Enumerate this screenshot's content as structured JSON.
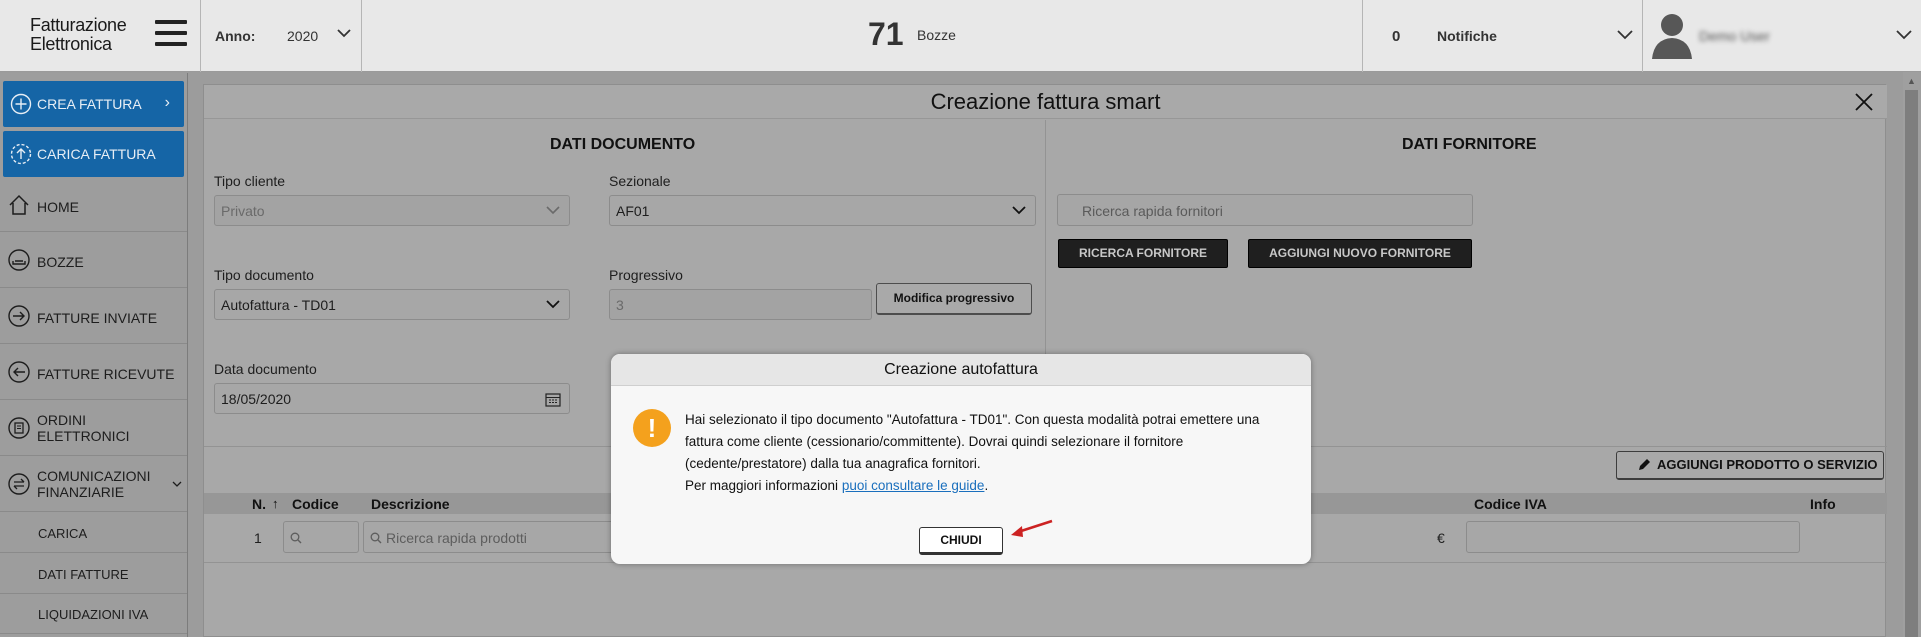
{
  "header": {
    "brand_line1": "Fatturazione",
    "brand_line2": "Elettronica",
    "anno_label": "Anno:",
    "anno_value": "2020",
    "bozze_count": "71",
    "bozze_label": "Bozze",
    "notifiche_count": "0",
    "notifiche_label": "Notifiche",
    "username": "Demo User"
  },
  "sidebar": {
    "crea_fattura": "CREA FATTURA",
    "carica_fattura": "CARICA FATTURA",
    "items": [
      {
        "label": "HOME",
        "icon": "home-icon"
      },
      {
        "label": "BOZZE",
        "icon": "drafts-icon"
      },
      {
        "label": "FATTURE INVIATE",
        "icon": "sent-icon"
      },
      {
        "label": "FATTURE RICEVUTE",
        "icon": "received-icon"
      },
      {
        "label": "ORDINI ELETTRONICI",
        "line1": "ORDINI",
        "line2": "ELETTRONICI",
        "icon": "orders-icon"
      },
      {
        "label": "COMUNICAZIONI FINANZIARIE",
        "line1": "COMUNICAZIONI",
        "line2": "FINANZIARIE",
        "icon": "exchange-icon"
      }
    ],
    "subitems": [
      "CARICA",
      "DATI FATTURE",
      "LIQUIDAZIONI IVA"
    ]
  },
  "panel": {
    "title": "Creazione fattura smart",
    "dati_documento": "DATI DOCUMENTO",
    "dati_fornitore": "DATI FORNITORE",
    "tipo_cliente_label": "Tipo cliente",
    "tipo_cliente_value": "Privato",
    "sezionale_label": "Sezionale",
    "sezionale_value": "AF01",
    "tipo_documento_label": "Tipo documento",
    "tipo_documento_value": "Autofattura - TD01",
    "progressivo_label": "Progressivo",
    "progressivo_value": "3",
    "modifica_progressivo": "Modifica progressivo",
    "data_documento_label": "Data documento",
    "data_documento_value": "18/05/2020",
    "ricerca_fornitori_placeholder": "Ricerca rapida fornitori",
    "ricerca_fornitore_btn": "RICERCA FORNITORE",
    "aggiungi_fornitore_btn": "AGGIUNGI NUOVO FORNITORE",
    "aggiungi_prodotto_btn": "AGGIUNGI PRODOTTO O SERVIZIO",
    "table_headers": {
      "n": "N.",
      "codice": "Codice",
      "descrizione": "Descrizione",
      "codice_iva": "Codice IVA",
      "info": "Info"
    },
    "row": {
      "n": "1",
      "ricerca_prodotti_placeholder": "Ricerca rapida prodotti",
      "currency": "€"
    }
  },
  "modal": {
    "title": "Creazione autofattura",
    "text_part1": "Hai selezionato il tipo documento \"Autofattura - TD01\". Con questa modalità potrai emettere una fattura come cliente (cessionario/committente). Dovrai quindi selezionare il fornitore (cedente/prestatore) dalla tua anagrafica fornitori.",
    "text_part2": "Per maggiori informazioni",
    "link_text": "puoi consultare le guide",
    "text_part3": ".",
    "close_button": "CHIUDI"
  },
  "colors": {
    "accent_blue": "#1565a6",
    "warning": "#f4a11d",
    "link": "#1a6fbd",
    "arrow_red": "#cc2222"
  }
}
